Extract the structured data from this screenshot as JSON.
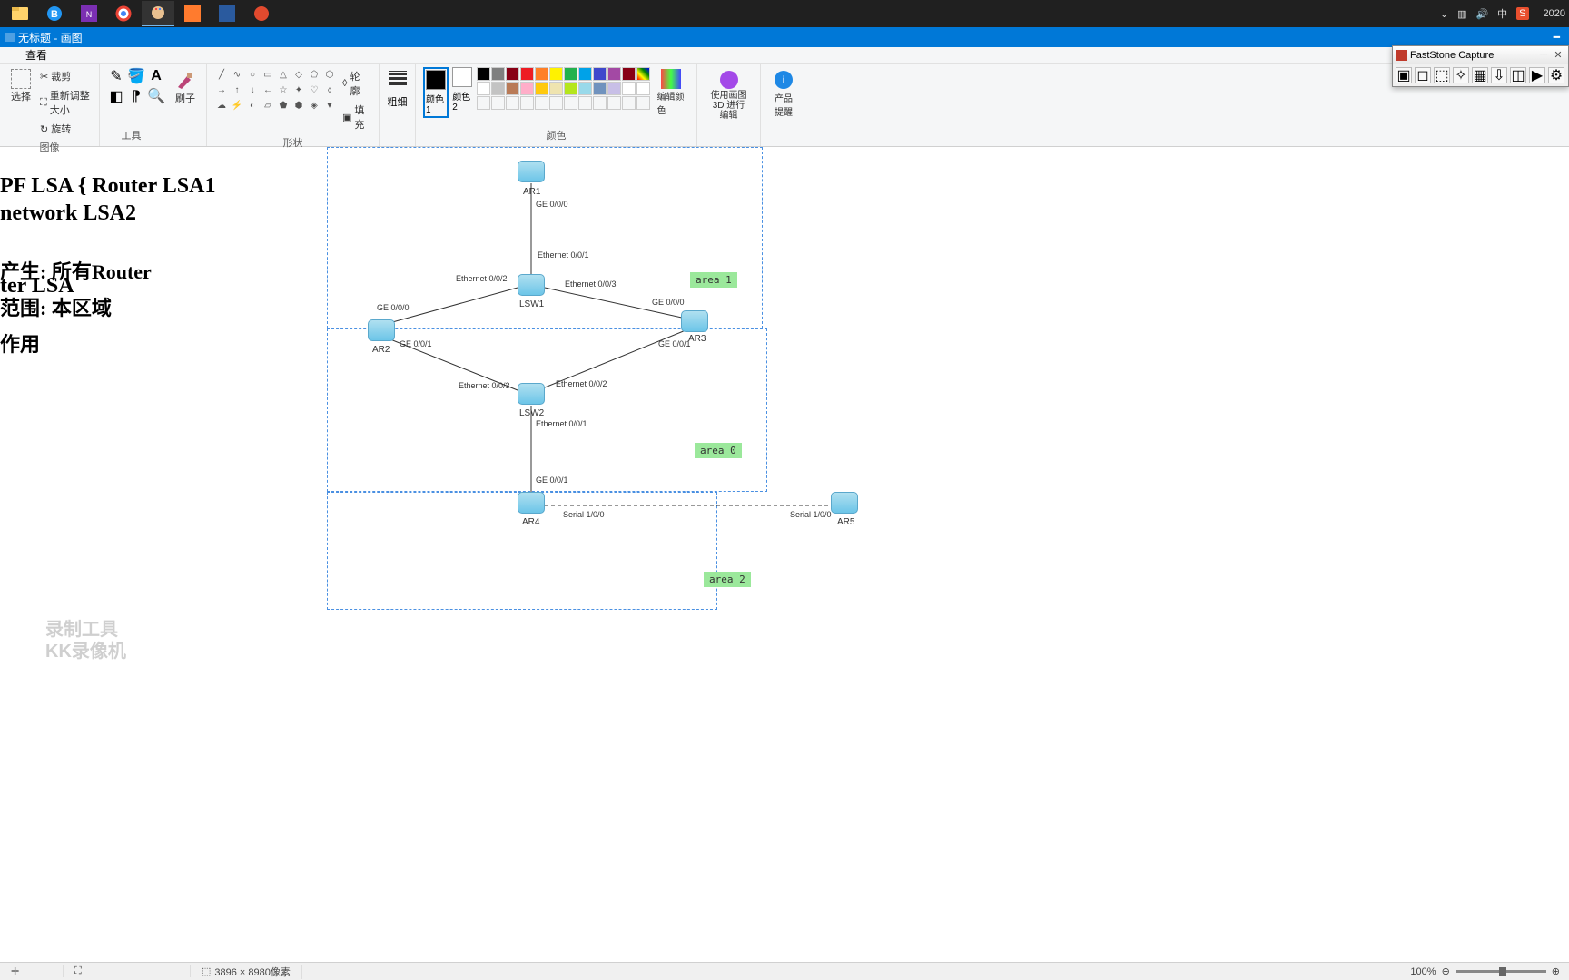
{
  "taskbar": {
    "clock_year": "2020",
    "ime": "中",
    "ime_brand": "S"
  },
  "window": {
    "title": "无标题 - 画图"
  },
  "menu": {
    "view": "查看"
  },
  "ribbon": {
    "image_group": "图像",
    "tools_group": "工具",
    "shapes_group": "形状",
    "colors_group": "颜色",
    "select": "选择",
    "crop": "裁剪",
    "resize": "重新调整大小",
    "rotate": "旋转",
    "brush": "刷子",
    "outline": "轮廓",
    "fill": "填充",
    "thickness": "粗细",
    "color1": "颜色 1",
    "color2": "颜色 2",
    "edit_colors": "编辑颜色",
    "paint3d": "使用画图 3D 进行编辑",
    "product_alert": "产品提醒"
  },
  "statusbar": {
    "dimensions": "3896 × 8980像素",
    "zoom": "100%"
  },
  "watermark": {
    "line1": "录制工具",
    "line2": "KK录像机"
  },
  "fsc": {
    "title": "FastStone Capture"
  },
  "diagram": {
    "areas": {
      "a0": "area 0",
      "a1": "area 1",
      "a2": "area 2"
    },
    "nodes": {
      "ar1": "AR1",
      "ar2": "AR2",
      "ar3": "AR3",
      "ar4": "AR4",
      "ar5": "AR5",
      "lsw1": "LSW1",
      "lsw2": "LSW2"
    },
    "ports": {
      "ge000": "GE 0/0/0",
      "ge001": "GE 0/0/1",
      "e001": "Ethernet 0/0/1",
      "e002": "Ethernet 0/0/2",
      "e003": "Ethernet 0/0/3",
      "s100": "Serial 1/0/0"
    }
  },
  "handwriting": {
    "l1": "PF  LSA { Router LSA1",
    "l2": "network LSA2",
    "l3": "ter  LSA",
    "l4": "产生: 所有Router",
    "l5": "范围: 本区域",
    "l6": "作用"
  }
}
